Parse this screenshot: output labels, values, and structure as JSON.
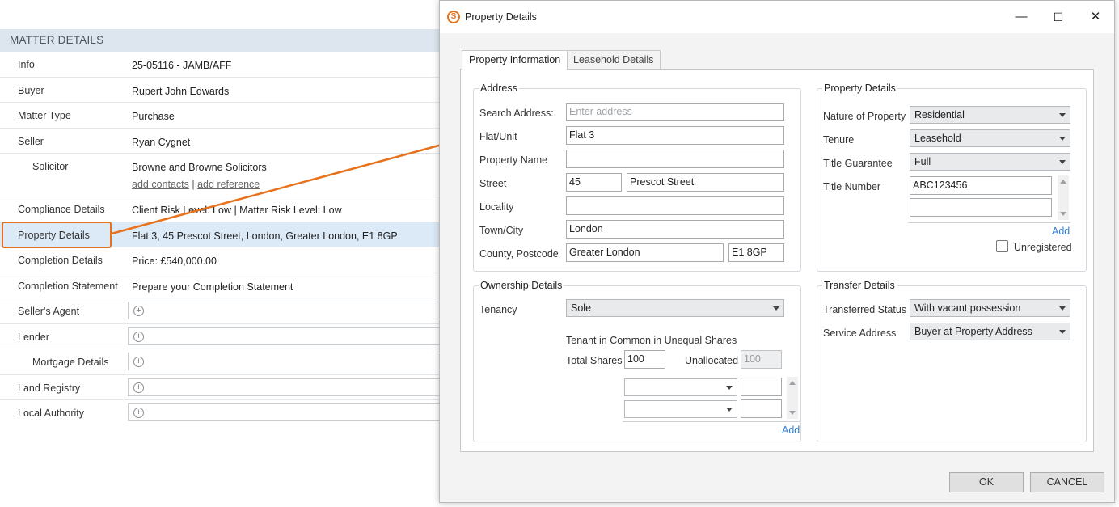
{
  "matter": {
    "header": "MATTER DETAILS",
    "rows": [
      {
        "label": "Info",
        "value": "25-05116 - JAMB/AFF"
      },
      {
        "label": "Buyer",
        "value": "Rupert John Edwards"
      },
      {
        "label": "Matter Type",
        "value": "Purchase"
      },
      {
        "label": "Seller",
        "value": "Ryan Cygnet"
      },
      {
        "label": "Solicitor",
        "value": "Browne and Browne Solicitors",
        "link1": "add contacts",
        "sep": "|",
        "link2": "add reference"
      },
      {
        "label": "Compliance Details",
        "value": "Client Risk Level: Low | Matter Risk Level: Low"
      },
      {
        "label": "Property Details",
        "value": "Flat 3, 45 Prescot Street, London, Greater London, E1 8GP"
      },
      {
        "label": "Completion Details",
        "value": "Price: £540,000.00"
      },
      {
        "label": "Completion Statement",
        "value": "Prepare your Completion Statement"
      },
      {
        "label": "Seller's Agent"
      },
      {
        "label": "Lender"
      },
      {
        "label": "Mortgage Details"
      },
      {
        "label": "Land Registry"
      },
      {
        "label": "Local Authority"
      }
    ]
  },
  "dialog": {
    "title": "Property Details",
    "window_buttons": {
      "minimize": "—",
      "maximize": "☐",
      "close": "✕"
    },
    "tabs": [
      "Property Information",
      "Leasehold Details"
    ],
    "address": {
      "title": "Address",
      "search_label": "Search Address:",
      "search_placeholder": "Enter address",
      "flat_label": "Flat/Unit",
      "flat_value": "Flat 3",
      "property_name_label": "Property Name",
      "property_name_value": "",
      "street_label": "Street",
      "street_number": "45",
      "street_name": "Prescot Street",
      "locality_label": "Locality",
      "locality_value": "",
      "town_label": "Town/City",
      "town_value": "London",
      "county_label": "County, Postcode",
      "county_value": "Greater London",
      "postcode_value": "E1 8GP"
    },
    "property_details": {
      "title": "Property Details",
      "nature_label": "Nature of Property",
      "nature_value": "Residential",
      "tenure_label": "Tenure",
      "tenure_value": "Leasehold",
      "guarantee_label": "Title Guarantee",
      "guarantee_value": "Full",
      "title_number_label": "Title Number",
      "title_number_value": "ABC123456",
      "title_number_value2": "",
      "add_label": "Add",
      "unregistered_label": "Unregistered"
    },
    "ownership": {
      "title": "Ownership Details",
      "tenancy_label": "Tenancy",
      "tenancy_value": "Sole",
      "unequal_label": "Tenant in Common in Unequal Shares",
      "total_shares_label": "Total Shares",
      "total_shares_value": "100",
      "unallocated_label": "Unallocated",
      "unallocated_value": "100",
      "add_label": "Add"
    },
    "transfer": {
      "title": "Transfer Details",
      "status_label": "Transferred Status",
      "status_value": "With vacant possession",
      "service_label": "Service Address",
      "service_value": "Buyer at Property Address"
    },
    "ok_label": "OK",
    "cancel_label": "CANCEL"
  },
  "colors": {
    "accent": "#e8721c",
    "highlight_row": "#dce9f7",
    "header_bg": "#dde6ef",
    "link": "#2f7dd1"
  }
}
